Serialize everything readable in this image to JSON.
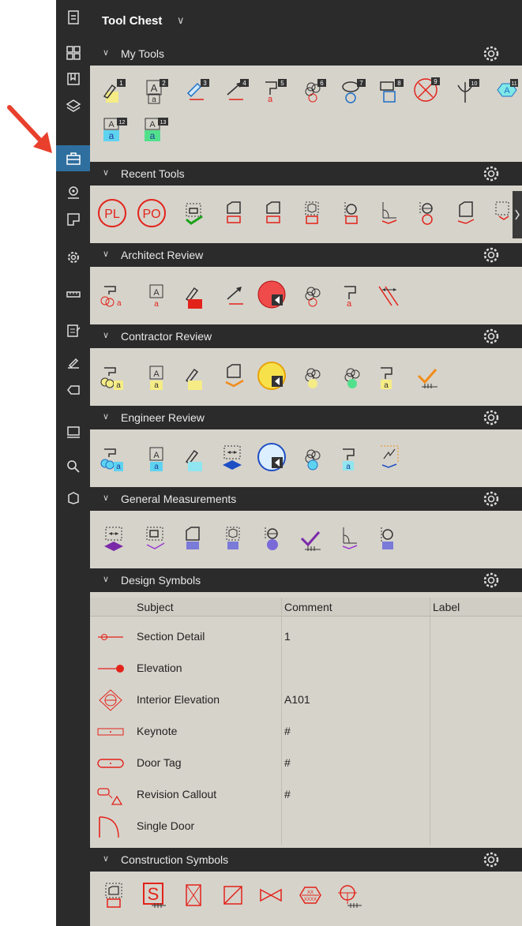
{
  "panel": {
    "title": "Tool Chest"
  },
  "colors": {
    "rail_bg": "#2b2b2b",
    "rail_active": "#2f6f9f",
    "tray_bg": "#d6d3cb",
    "markup_red": "#e2231a",
    "callout_arrow": "#e8402c"
  },
  "rail": {
    "items": [
      "file-icon",
      "thumbnails-icon",
      "bookmarks-icon",
      "layers-icon",
      "tool-chest-icon",
      "location-icon",
      "spaces-icon",
      "settings-icon",
      "measure-icon",
      "markups-list-icon",
      "signatures-icon",
      "tag-icon",
      "stamp-icon",
      "search-icon",
      "3d-icon"
    ],
    "active": "tool-chest-icon"
  },
  "sections": {
    "my_tools": {
      "label": "My Tools",
      "badges": [
        "1",
        "2",
        "3",
        "4",
        "5",
        "6",
        "7",
        "8",
        "9",
        "10",
        "11",
        "12",
        "13"
      ]
    },
    "recent_tools": {
      "label": "Recent Tools",
      "badges": [
        "PL",
        "PO"
      ]
    },
    "architect_review": {
      "label": "Architect Review"
    },
    "contractor_review": {
      "label": "Contractor Review"
    },
    "engineer_review": {
      "label": "Engineer Review"
    },
    "general_measurements": {
      "label": "General Measurements"
    },
    "design_symbols": {
      "label": "Design Symbols"
    },
    "construction_symbols": {
      "label": "Construction Symbols"
    }
  },
  "design_table": {
    "columns": [
      "Subject",
      "Comment",
      "Label"
    ],
    "rows": [
      {
        "subject": "Section Detail",
        "comment": "1",
        "label": ""
      },
      {
        "subject": "Elevation",
        "comment": "",
        "label": ""
      },
      {
        "subject": "Interior Elevation",
        "comment": "A101",
        "label": ""
      },
      {
        "subject": "Keynote",
        "comment": "#",
        "label": ""
      },
      {
        "subject": "Door Tag",
        "comment": "#",
        "label": ""
      },
      {
        "subject": "Revision Callout",
        "comment": "#",
        "label": ""
      },
      {
        "subject": "Single Door",
        "comment": "",
        "label": ""
      }
    ]
  },
  "tool_glyphs": {
    "text_box": "A",
    "subscript": "a",
    "symbol_xx": "XX",
    "symbol_xxxx": "XXXX",
    "construction_s": "S"
  }
}
